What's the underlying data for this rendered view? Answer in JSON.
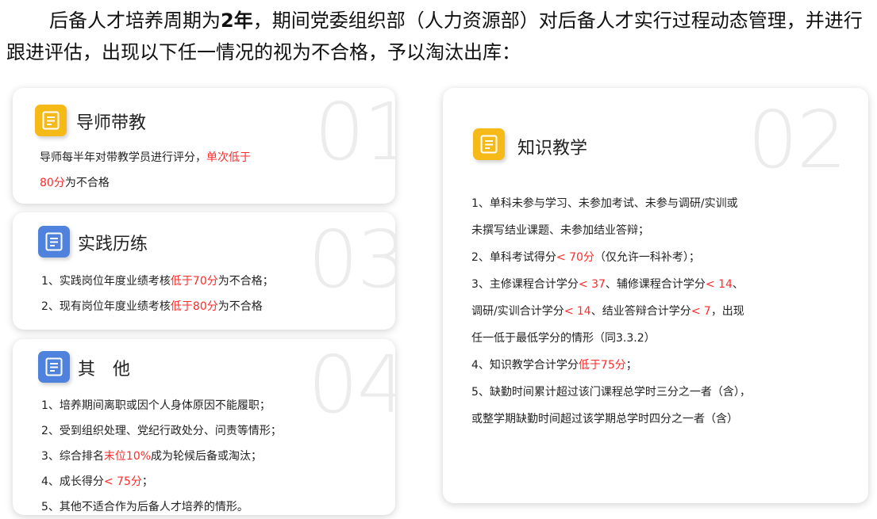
{
  "intro": {
    "line1_a": "后备人才培养周期为",
    "line1_b": "2年",
    "line1_c": "，期间党委组织部（人力资源部）对后备人才实行过程动态",
    "line2": "管理，并进行跟进评估，出现以下任一情况的视为不合格，予以淘汰出库："
  },
  "colors": {
    "red": "#ff2a2a",
    "yellow": "#f6ba18",
    "blue": "#4f82dc"
  },
  "cards": {
    "c01": {
      "number": "01",
      "icon": "document-icon",
      "title": "导师带教",
      "l1a": "导师每半年对带教学员进行评分，",
      "l1b": "单次低于",
      "l2a": "80分",
      "l2b": "为不合格"
    },
    "c03": {
      "number": "03",
      "icon": "document-icon",
      "title": "实践历练",
      "l1a": "1、实践岗位年度业绩考核",
      "l1b": "低于70分",
      "l1c": "为不合格；",
      "l2a": "2、现有岗位年度业绩考核",
      "l2b": "低于80分",
      "l2c": "为不合格"
    },
    "c04": {
      "number": "04",
      "icon": "document-icon",
      "title": "其　他",
      "l1": "1、培养期间离职或因个人身体原因不能履职；",
      "l2": "2、受到组织处理、党纪行政处分、问责等情形；",
      "l3a": "3、综合排名",
      "l3b": "末位10%",
      "l3c": "成为轮候后备或淘汰；",
      "l4a": "4、成长得分",
      "l4b": "< 75分",
      "l4c": "；",
      "l5": "5、其他不适合作为后备人才培养的情形。"
    },
    "c02": {
      "number": "02",
      "icon": "document-icon",
      "title": "知识教学",
      "l1": "1、单科未参与学习、未参加考试、未参与调研/实训或",
      "l2": "未撰写结业课题、未参加结业答辩；",
      "l3a": "2、单科考试得分",
      "l3b": "< 70分",
      "l3c": "（仅允许一科补考）；",
      "l4a": "3、主修课程合计学分",
      "l4b": "< 37",
      "l4c": "、辅修课程合计学分",
      "l4d": "< 14",
      "l4e": "、",
      "l5a": "调研/实训合计学分",
      "l5b": "< 14",
      "l5c": "、结业答辩合计学分",
      "l5d": "< 7",
      "l5e": "，出现",
      "l6": "任一低于最低学分的情形（同3.3.2）",
      "l7a": "4、知识教学合计学分",
      "l7b": "低于75分",
      "l7c": "；",
      "l8": "5、缺勤时间累计超过该门课程总学时三分之一者（含），",
      "l9": "或整学期缺勤时间超过该学期总学时四分之一者（含）"
    }
  }
}
